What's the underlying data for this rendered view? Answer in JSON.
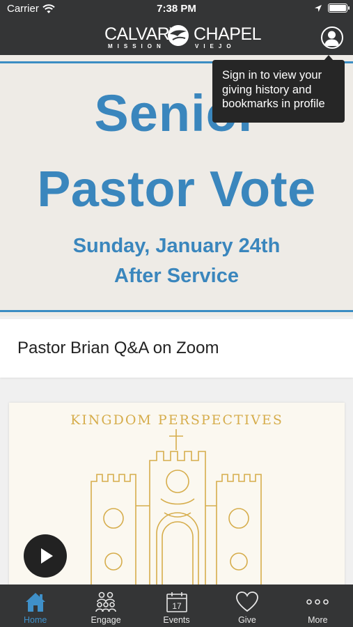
{
  "status_bar": {
    "carrier": "Carrier",
    "time": "7:38 PM"
  },
  "header": {
    "logo_word_left": "CALVARY",
    "logo_word_right": "CHAPEL",
    "logo_sub_left": "MISSION",
    "logo_sub_right": "VIEJO",
    "profile_icon": "user-circle-icon"
  },
  "tooltip": {
    "text": "Sign in to view your giving history and bookmarks in profile"
  },
  "banner": {
    "line1": "Senior",
    "line2": "Pastor Vote",
    "line3": "Sunday, January 24th",
    "line4": "After Service",
    "accent_color": "#3a86bd"
  },
  "item_title": "Pastor Brian Q&A on Zoom",
  "media": {
    "title": "KINGDOM PERSPECTIVES",
    "gold_color": "#d6ad4c",
    "play_icon": "play-icon"
  },
  "tabs": [
    {
      "label": "Home",
      "icon": "home-icon",
      "active": true
    },
    {
      "label": "Engage",
      "icon": "people-icon",
      "active": false
    },
    {
      "label": "Events",
      "icon": "calendar-icon",
      "active": false,
      "icon_text": "17"
    },
    {
      "label": "Give",
      "icon": "heart-icon",
      "active": false
    },
    {
      "label": "More",
      "icon": "ellipsis-icon",
      "active": false
    }
  ]
}
